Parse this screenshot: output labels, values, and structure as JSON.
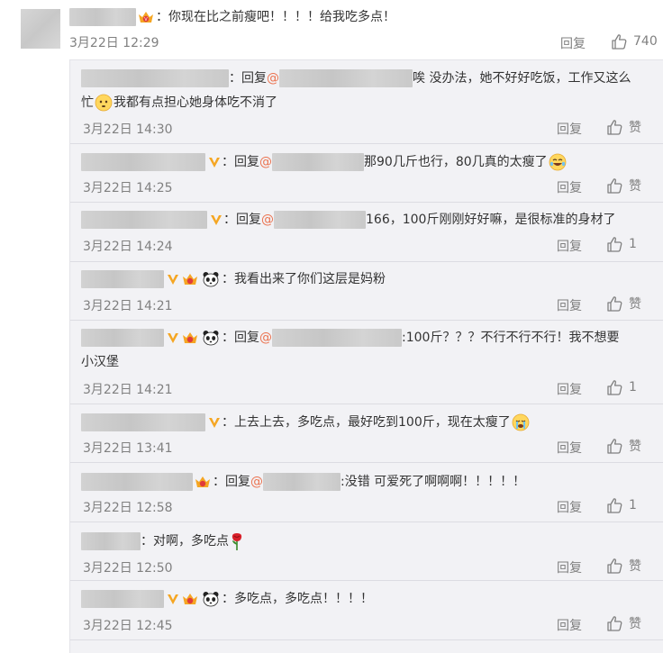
{
  "main_comment": {
    "text": "：你现在比之前瘦吧！！！！给我吃多点！",
    "time": "3月22日 12:29",
    "reply_label": "回复",
    "like_count": "740"
  },
  "replies": [
    {
      "prefix": "：回复",
      "mention": "@",
      "text": "唉 没办法，她不好好吃饭，工作又这么",
      "text2_a": "忙",
      "text2_b": "我都有点担心她身体吃不消了",
      "time": "3月22日 14:30",
      "reply_label": "回复",
      "like_label": "赞"
    },
    {
      "prefix": "：回复",
      "mention": "@",
      "text": "那90几斤也行，80几真的太瘦了",
      "time": "3月22日 14:25",
      "reply_label": "回复",
      "like_label": "赞"
    },
    {
      "prefix": "：回复",
      "mention": "@",
      "text": "166，100斤刚刚好好嘛，是很标准的身材了",
      "time": "3月22日 14:24",
      "reply_label": "回复",
      "like_label": "1"
    },
    {
      "text": "：我看出来了你们这层是妈粉",
      "time": "3月22日 14:21",
      "reply_label": "回复",
      "like_label": "赞"
    },
    {
      "prefix": "：回复",
      "mention": "@",
      "text": ":100斤？？？不行不行不行！我不想要",
      "text2": "小汉堡",
      "time": "3月22日 14:21",
      "reply_label": "回复",
      "like_label": "1"
    },
    {
      "text": "：上去上去，多吃点，最好吃到100斤，现在太瘦了",
      "time": "3月22日 13:41",
      "reply_label": "回复",
      "like_label": "赞"
    },
    {
      "prefix": "：回复",
      "mention": "@",
      "text": ":没错 可爱死了啊啊啊！！！！！",
      "time": "3月22日 12:58",
      "reply_label": "回复",
      "like_label": "1"
    },
    {
      "text": "：对啊，多吃点",
      "time": "3月22日 12:50",
      "reply_label": "回复",
      "like_label": "赞"
    },
    {
      "text": "：多吃点，多吃点！！！！",
      "time": "3月22日 12:45",
      "reply_label": "回复",
      "like_label": "赞"
    }
  ],
  "icons": {
    "thumb": "thumbs-up-icon",
    "vip": "vip-crown-badge-icon",
    "verified": "verified-v-badge-icon",
    "panda": "panda-badge-icon"
  },
  "colors": {
    "mention": "#eb7350",
    "meta": "#808080",
    "panel_bg": "#f2f2f5",
    "badge_gold": "#f5a623"
  }
}
